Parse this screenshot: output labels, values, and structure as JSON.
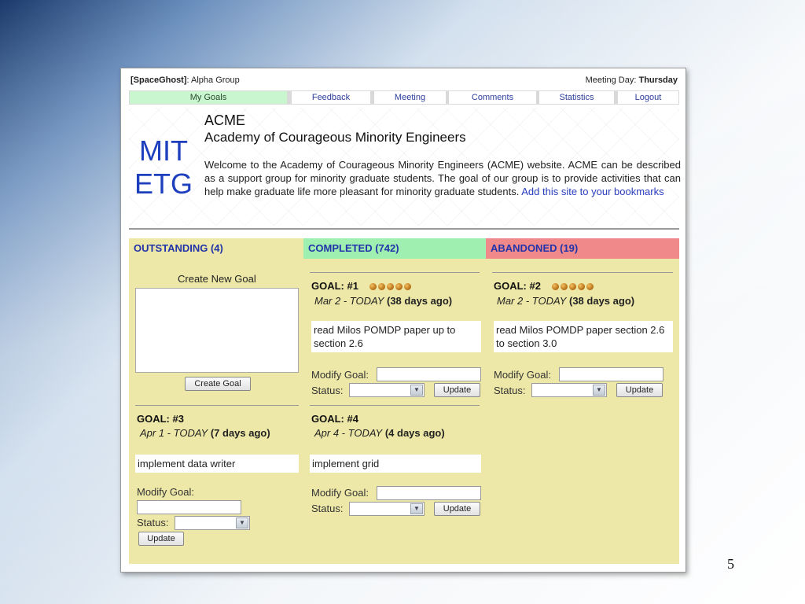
{
  "slide": {
    "page_number": "5"
  },
  "topbar": {
    "user_prefix": "[SpaceGhost]",
    "group": ": Alpha Group",
    "meeting_label": "Meeting Day:",
    "meeting_day": "Thursday"
  },
  "nav": {
    "my_goals": "My Goals",
    "feedback": "Feedback",
    "meeting": "Meeting",
    "comments": "Comments",
    "statistics": "Statistics",
    "logout": "Logout"
  },
  "header": {
    "logo_line1": "MIT",
    "logo_line2": "ETG",
    "title": "ACME",
    "subtitle": "Academy of Courageous Minority Engineers",
    "welcome": "Welcome to the Academy of Courageous Minority Engineers (ACME) website. ACME can be described as a support group for minority graduate students. The goal of our group is to provide activities that can help make graduate life more pleasant for minority graduate students.",
    "bookmark_link": "Add this site to your bookmarks"
  },
  "columns": {
    "outstanding": "OUTSTANDING (4)",
    "completed": "COMPLETED (742)",
    "abandoned": "ABANDONED (19)"
  },
  "create": {
    "label": "Create New Goal",
    "button": "Create Goal"
  },
  "form": {
    "modify_label": "Modify Goal:",
    "status_label": "Status:",
    "update_button": "Update"
  },
  "goals": {
    "g1": {
      "title": "GOAL: #1",
      "rating": 5,
      "date_range": "Mar 2 - TODAY",
      "ago": "(38 days ago)",
      "description": "read Milos POMDP paper up to section 2.6"
    },
    "g2": {
      "title": "GOAL: #2",
      "rating": 5,
      "date_range": "Mar 2 - TODAY",
      "ago": "(38 days ago)",
      "description": "read Milos POMDP paper section 2.6 to section 3.0"
    },
    "g3": {
      "title": "GOAL: #3",
      "date_range": "Apr 1 - TODAY",
      "ago": "(7 days ago)",
      "description": "implement data writer"
    },
    "g4": {
      "title": "GOAL: #4",
      "date_range": "Apr 4 - TODAY",
      "ago": "(4 days ago)",
      "description": "implement grid"
    }
  },
  "colors": {
    "board": "#ede8a8",
    "completed_header": "#9ff0b0",
    "abandoned_header": "#f08a8a",
    "active_tab": "#c9f5cf",
    "link": "#2a3dbe"
  }
}
